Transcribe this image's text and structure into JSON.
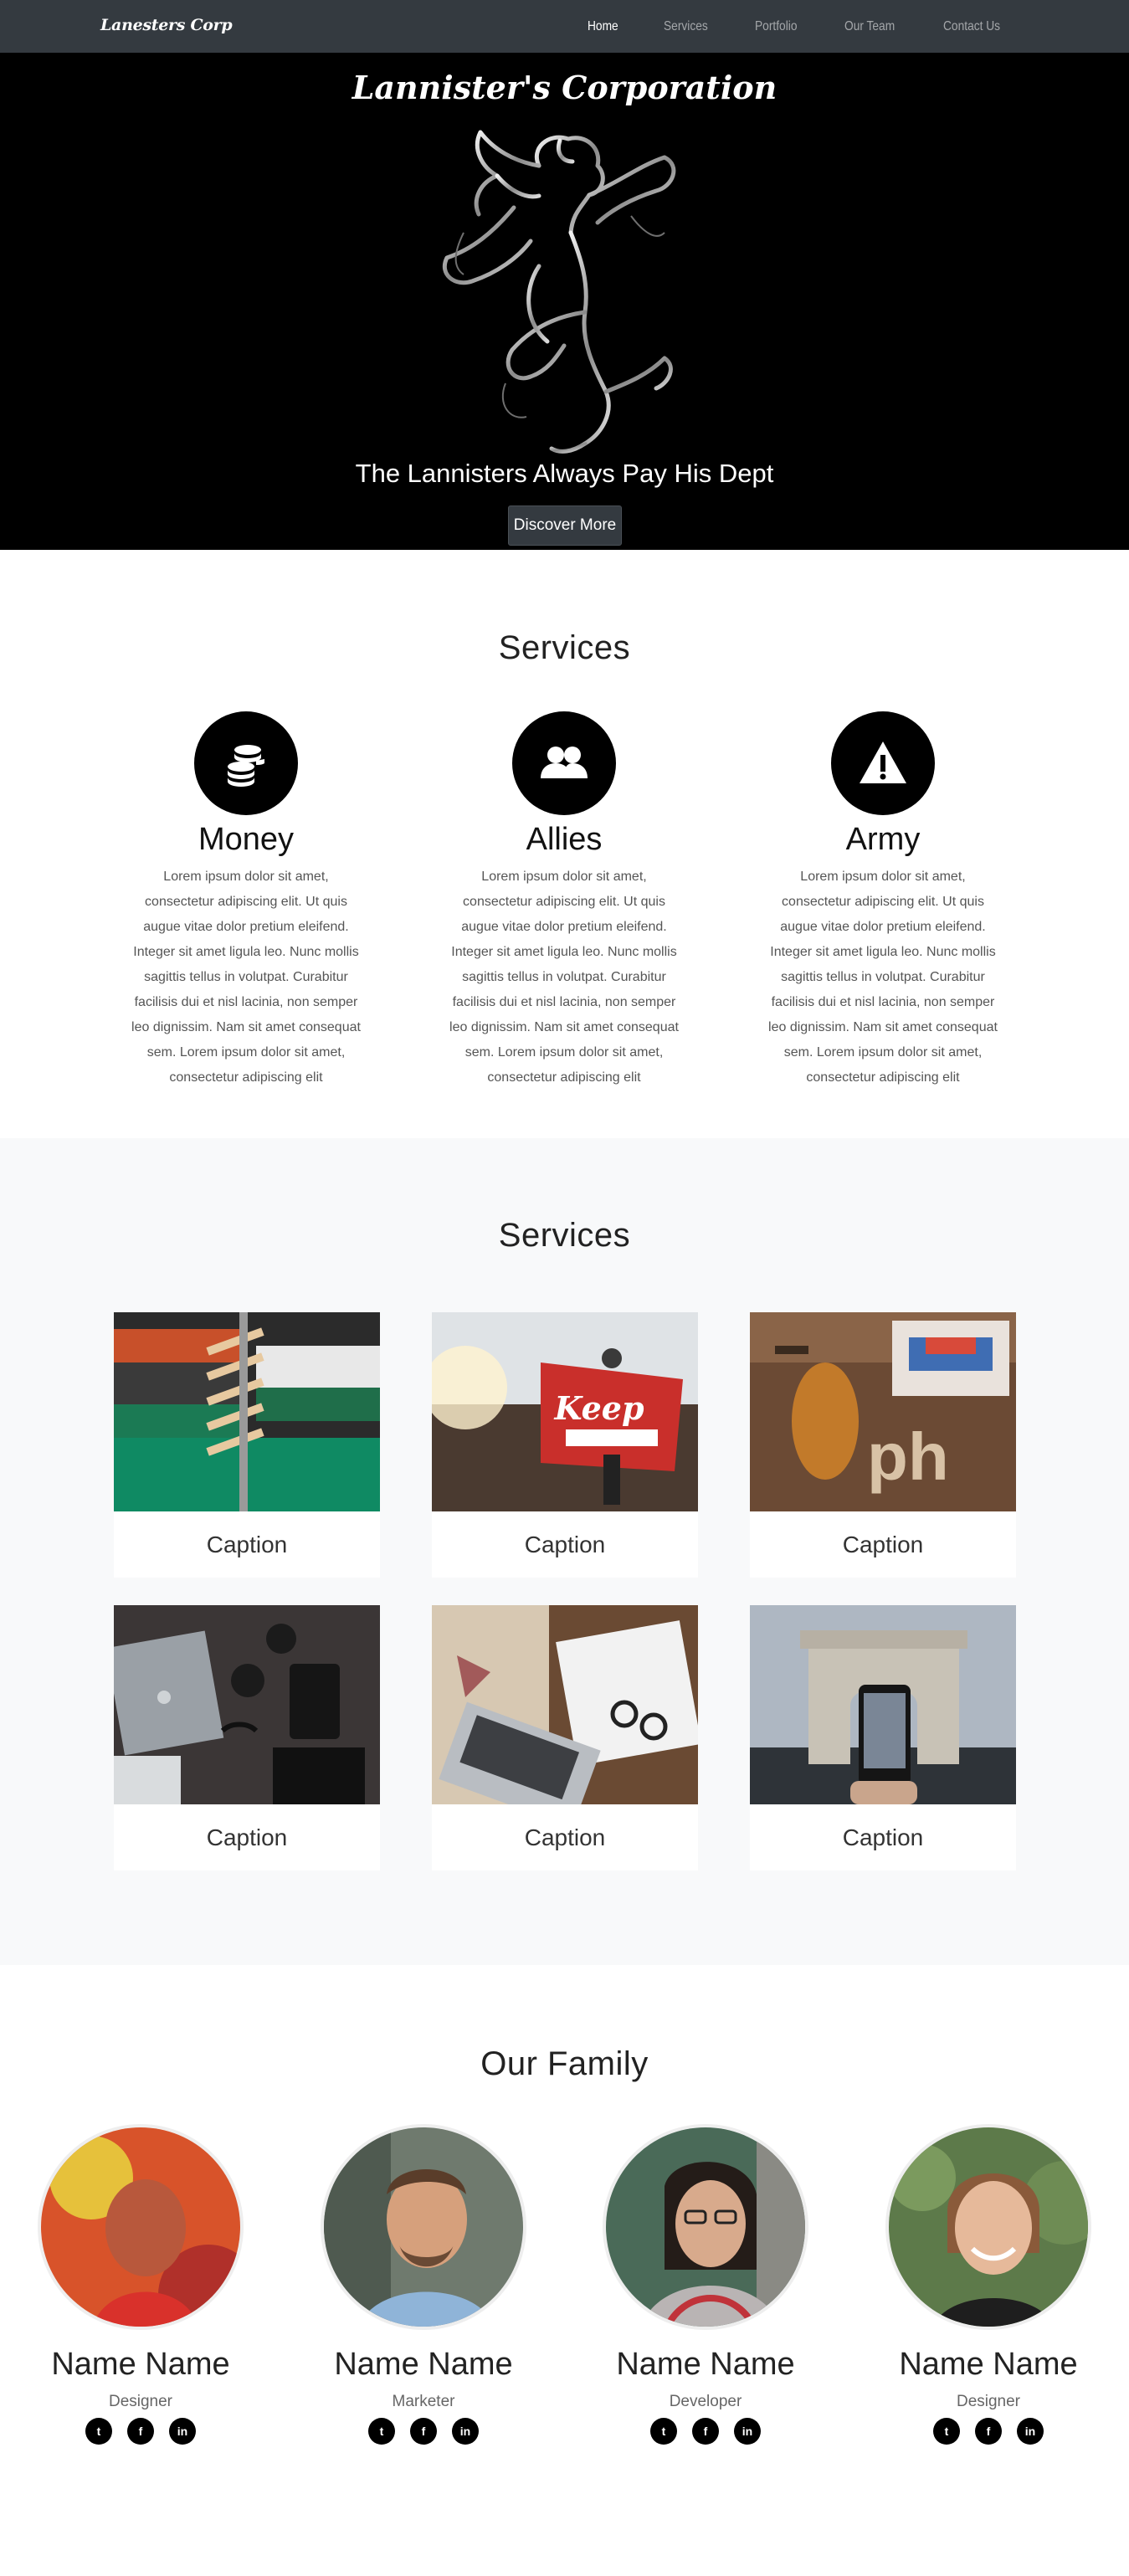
{
  "navbar": {
    "brand": "Lanesters Corp",
    "links": [
      {
        "label": "Home"
      },
      {
        "label": "Services"
      },
      {
        "label": "Portfolio"
      },
      {
        "label": "Our Team"
      },
      {
        "label": "Contact Us"
      }
    ]
  },
  "hero": {
    "title": "Lannister's Corporation",
    "tagline": "The Lannisters Always Pay His Dept",
    "button": "Discover More"
  },
  "services": {
    "title": "Services",
    "items": [
      {
        "heading": "Money",
        "icon": "coins-icon",
        "text": "Lorem ipsum dolor sit amet, consectetur adipiscing elit. Ut quis augue vitae dolor pretium eleifend. Integer sit amet ligula leo. Nunc mollis sagittis tellus in volutpat. Curabitur facilisis dui et nisl lacinia, non semper leo dignissim. Nam sit amet consequat sem. Lorem ipsum dolor sit amet, consectetur adipiscing elit"
      },
      {
        "heading": "Allies",
        "icon": "users-icon",
        "text": "Lorem ipsum dolor sit amet, consectetur adipiscing elit. Ut quis augue vitae dolor pretium eleifend. Integer sit amet ligula leo. Nunc mollis sagittis tellus in volutpat. Curabitur facilisis dui et nisl lacinia, non semper leo dignissim. Nam sit amet consequat sem. Lorem ipsum dolor sit amet, consectetur adipiscing elit"
      },
      {
        "heading": "Army",
        "icon": "warning-icon",
        "text": "Lorem ipsum dolor sit amet, consectetur adipiscing elit. Ut quis augue vitae dolor pretium eleifend. Integer sit amet ligula leo. Nunc mollis sagittis tellus in volutpat. Curabitur facilisis dui et nisl lacinia, non semper leo dignissim. Nam sit amet consequat sem. Lorem ipsum dolor sit amet, consectetur adipiscing elit"
      }
    ]
  },
  "portfolio": {
    "title": "Services",
    "items": [
      {
        "caption": "Caption"
      },
      {
        "caption": "Caption"
      },
      {
        "caption": "Caption"
      },
      {
        "caption": "Caption"
      },
      {
        "caption": "Caption"
      },
      {
        "caption": "Caption"
      }
    ]
  },
  "team": {
    "title": "Our Family",
    "members": [
      {
        "name": "Name Name",
        "role": "Designer"
      },
      {
        "name": "Name Name",
        "role": "Marketer"
      },
      {
        "name": "Name Name",
        "role": "Developer"
      },
      {
        "name": "Name Name",
        "role": "Designer"
      }
    ],
    "social_icons": [
      "twitter-icon",
      "facebook-icon",
      "linkedin-icon"
    ]
  }
}
